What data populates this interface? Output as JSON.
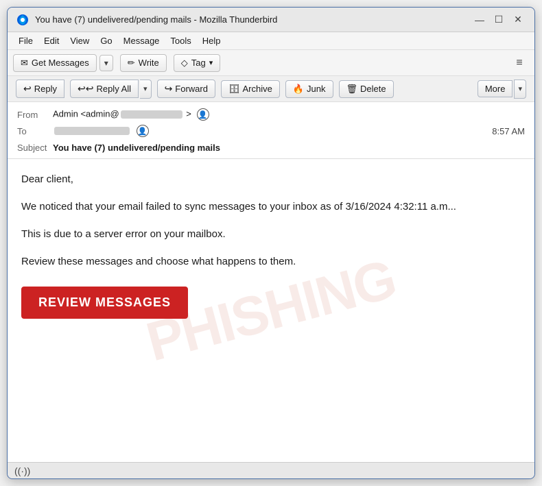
{
  "window": {
    "title": "You have (7) undelivered/pending mails - Mozilla Thunderbird",
    "icon": "🦅",
    "controls": {
      "minimize": "—",
      "maximize": "☐",
      "close": "✕"
    }
  },
  "menubar": {
    "items": [
      "File",
      "Edit",
      "View",
      "Go",
      "Message",
      "Tools",
      "Help"
    ]
  },
  "toolbar": {
    "get_messages_label": "Get Messages",
    "write_label": "Write",
    "tag_label": "Tag"
  },
  "actions": {
    "reply": "Reply",
    "reply_all": "Reply All",
    "forward": "Forward",
    "archive": "Archive",
    "junk": "Junk",
    "delete": "Delete",
    "more": "More"
  },
  "email_header": {
    "from_label": "From",
    "from_name": "Admin <admin@",
    "to_label": "To",
    "time": "8:57 AM",
    "subject_label": "Subject",
    "subject": "You have (7) undelivered/pending mails"
  },
  "email_body": {
    "greeting": "Dear client,",
    "para1": "We noticed that your email failed to sync messages to your inbox as of 3/16/2024 4:32:11 a.m...",
    "para2": "This is due to a server error on your mailbox.",
    "para3": "Review these messages and choose what happens to them.",
    "cta": "REVIEW MESSAGES",
    "watermark": "PHISHING"
  },
  "statusbar": {
    "wifi_icon": "((·))"
  }
}
